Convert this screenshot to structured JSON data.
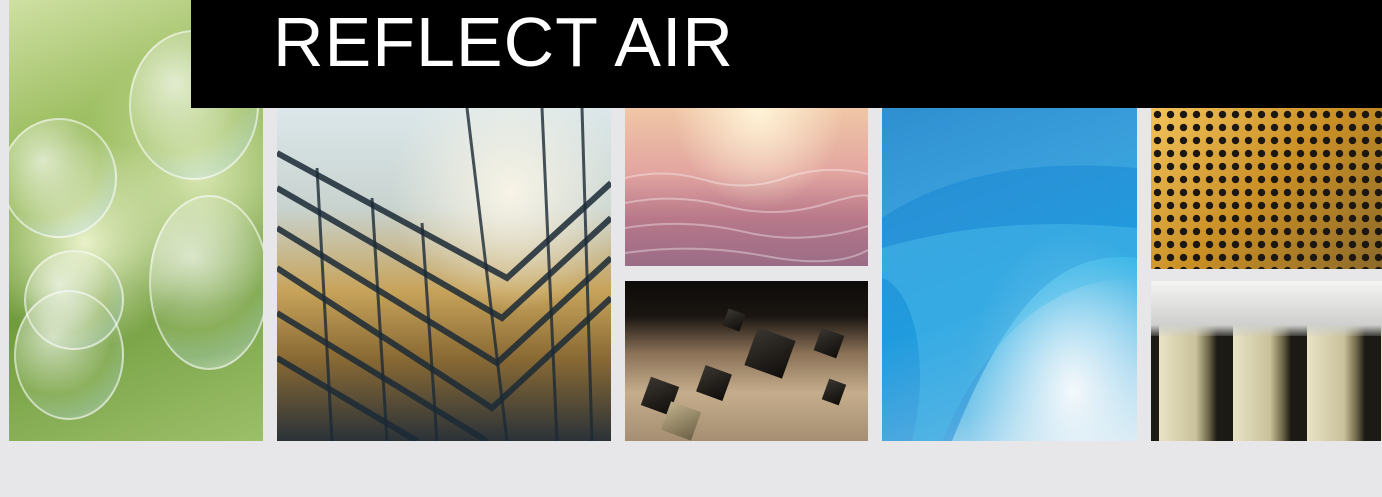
{
  "banner": {
    "title": "REFLECT AIR"
  },
  "colors": {
    "banner_bg": "#000000",
    "banner_text": "#ffffff",
    "page_bg": "#e7e7e9"
  }
}
